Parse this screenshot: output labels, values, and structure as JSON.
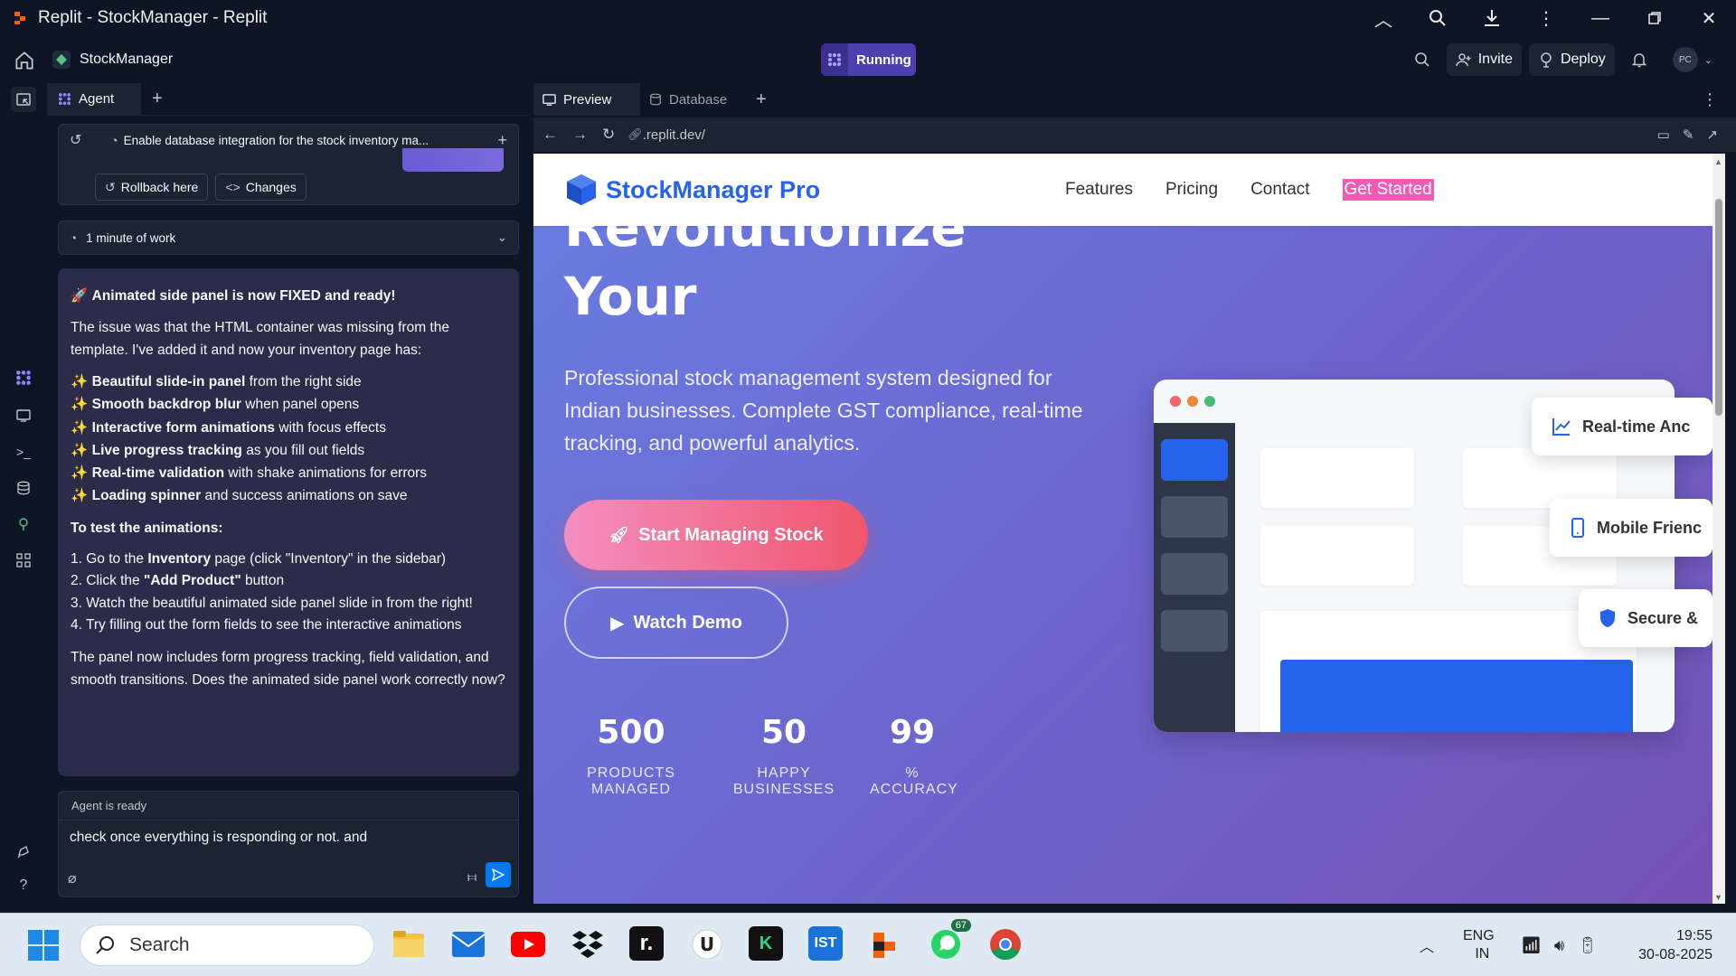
{
  "window": {
    "title": "Replit - StockManager - Replit"
  },
  "header": {
    "project_name": "StockManager",
    "run_status": "Running",
    "invite_label": "Invite",
    "deploy_label": "Deploy",
    "avatar_initials": "PC"
  },
  "agent_panel": {
    "tab_label": "Agent",
    "task_title": "Enable database integration for the stock inventory ma...",
    "rollback_label": "Rollback here",
    "changes_label": "Changes",
    "work_summary": "1 minute of work",
    "message": {
      "heading": "Animated side panel is now FIXED and ready!",
      "intro": "The issue was that the HTML container was missing from the template. I've added it and now your inventory page has:",
      "features": [
        {
          "bold": "Beautiful slide-in panel",
          "rest": " from the right side"
        },
        {
          "bold": "Smooth backdrop blur",
          "rest": " when panel opens"
        },
        {
          "bold": "Interactive form animations",
          "rest": " with focus effects"
        },
        {
          "bold": "Live progress tracking",
          "rest": " as you fill out fields"
        },
        {
          "bold": "Real-time validation",
          "rest": " with shake animations for errors"
        },
        {
          "bold": "Loading spinner",
          "rest": " and success animations on save"
        }
      ],
      "test_heading": "To test the animations:",
      "steps": {
        "s1_a": "1. Go to the ",
        "s1_b": "Inventory",
        "s1_c": " page (click \"Inventory\" in the sidebar)",
        "s2_a": "2. Click the ",
        "s2_b": "\"Add Product\"",
        "s2_c": " button",
        "s3": "3. Watch the beautiful animated side panel slide in from the right!",
        "s4": "4. Try filling out the form fields to see the interactive animations"
      },
      "closing": "The panel now includes form progress tracking, field validation, and smooth transitions. Does the animated side panel work correctly now?"
    },
    "input_status": "Agent is ready",
    "input_text": "check once everything is responding or not. and"
  },
  "preview": {
    "tabs": [
      "Preview",
      "Database"
    ],
    "url": ".replit.dev/"
  },
  "site": {
    "brand": "StockManager Pro",
    "nav": [
      "Features",
      "Pricing",
      "Contact"
    ],
    "get_started": "Get Started",
    "hero_line1": "Revolutionize",
    "hero_line2": "Your",
    "subtitle": "Professional stock management system designed for Indian businesses. Complete GST compliance, real-time tracking, and powerful analytics.",
    "cta_primary": "Start Managing Stock",
    "cta_secondary": "Watch Demo",
    "stats": [
      {
        "value": "500",
        "label": "PRODUCTS MANAGED"
      },
      {
        "value": "50",
        "label": "HAPPY BUSINESSES"
      },
      {
        "value": "99",
        "label": "% ACCURACY"
      }
    ],
    "pills": [
      "Real-time Anc",
      "Mobile Frienc",
      "Secure &"
    ]
  },
  "taskbar": {
    "search_placeholder": "Search",
    "whatsapp_badge": "67",
    "lang_1": "ENG",
    "lang_2": "IN",
    "time": "19:55",
    "date": "30-08-2025"
  },
  "colors": {
    "accent": "#0079f2",
    "run": "#4e3fb0",
    "brand": "#2563eb",
    "cta": "#f0566c"
  }
}
